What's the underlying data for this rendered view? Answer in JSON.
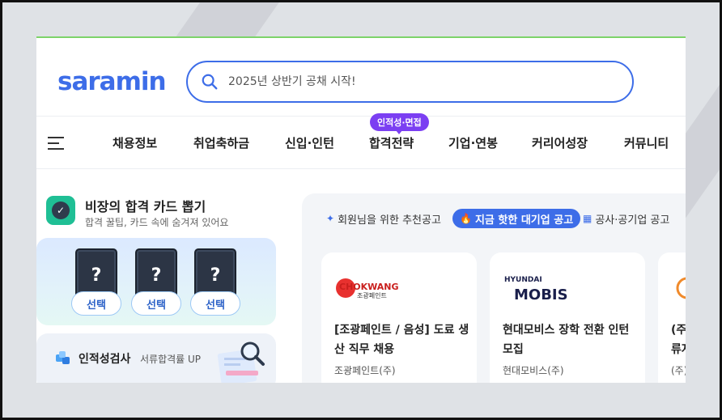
{
  "header": {
    "logo_text": "saramin",
    "search_placeholder": "2025년 상반기 공채 시작!"
  },
  "nav": {
    "items": [
      "채용정보",
      "취업축하금",
      "신입·인턴",
      "합격전략",
      "기업·연봉",
      "커리어성장",
      "커뮤니티"
    ],
    "badge": "인적성·면접"
  },
  "card_game": {
    "title": "비장의 합격 카드 뽑기",
    "subtitle": "합격 꿀팁, 카드 속에 숨겨져 있어요",
    "cards": [
      {
        "symbol": "?",
        "button": "선택"
      },
      {
        "symbol": "?",
        "button": "선택"
      },
      {
        "symbol": "?",
        "button": "선택"
      }
    ]
  },
  "aptitude": {
    "title": "인적성검사",
    "subtitle": "서류합격률 UP"
  },
  "recommend": {
    "tabs": [
      {
        "label": "회원님을 위한 추천공고",
        "icon": "sparkle-icon",
        "active": false
      },
      {
        "label": "지금 핫한 대기업 공고",
        "icon": "fire-icon",
        "active": true
      },
      {
        "label": "공사·공기업 공고",
        "icon": "building-icon",
        "active": false
      }
    ],
    "jobs": [
      {
        "logo_line1": "CHOKWANG",
        "logo_line2": "조광페인트",
        "title": "[조광페인트 / 음성] 도료 생산 직무 채용",
        "company": "조광페인트(주)"
      },
      {
        "logo_line1": "HYUNDAI",
        "logo_line2": "MOBIS",
        "title": "현대모비스 장학 전환 인턴 모집",
        "company": "현대모비스(주)"
      },
      {
        "logo_line1": "",
        "logo_line2": "",
        "title": "(주\n류자",
        "company": "(주)"
      }
    ]
  },
  "colors": {
    "brand": "#3d6de8",
    "badge": "#7b3ff2",
    "topline": "#7dd36a"
  }
}
